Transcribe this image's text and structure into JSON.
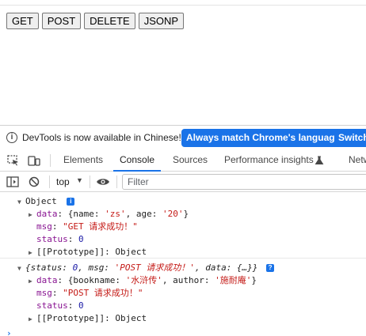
{
  "page": {
    "buttons": [
      "GET",
      "POST",
      "DELETE",
      "JSONP"
    ]
  },
  "devtools": {
    "infobar": {
      "text": "DevTools is now available in Chinese!",
      "match_label": "Always match Chrome's language",
      "switch_label": "Switch"
    },
    "tabs": {
      "elements": "Elements",
      "console": "Console",
      "sources": "Sources",
      "performance": "Performance insights",
      "network": "Netw"
    },
    "toolbar": {
      "context": "top",
      "filter_placeholder": "Filter"
    },
    "console": {
      "entry1": {
        "header": "Object",
        "data_key": "data",
        "data_prefix": "{name: ",
        "data_name": "'zs'",
        "data_mid": ", age: ",
        "data_age": "'20'",
        "data_suffix": "}",
        "msg_key": "msg",
        "msg_value": "\"GET 请求成功！\"",
        "status_key": "status",
        "status_value": "0",
        "proto": "[[Prototype]]: Object"
      },
      "entry2": {
        "header_a": "{status: ",
        "header_status": "0",
        "header_b": ", msg: ",
        "header_msg": "'POST 请求成功！'",
        "header_c": ", data: {…}}",
        "data_key": "data",
        "data_prefix": "{bookname: ",
        "data_book": "'水浒传'",
        "data_mid": ", author: ",
        "data_author": "'施耐庵'",
        "data_suffix": "}",
        "msg_key": "msg",
        "msg_value": "\"POST 请求成功！\"",
        "status_key": "status",
        "status_value": "0",
        "proto": "[[Prototype]]: Object"
      }
    }
  },
  "colors": {
    "accent": "#1a73e8",
    "string": "#c41a16",
    "key": "#881391",
    "number": "#1a1aa6"
  }
}
